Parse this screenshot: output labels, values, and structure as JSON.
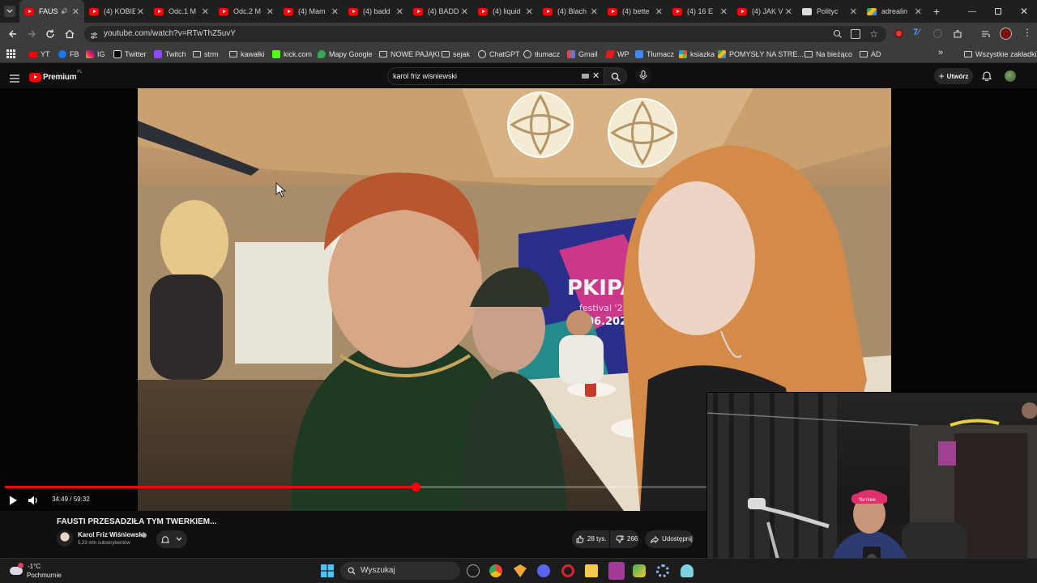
{
  "tabs": [
    {
      "title": "FAUS",
      "active": true
    },
    {
      "title": "(4) KOBIE"
    },
    {
      "title": "Odc.1 M"
    },
    {
      "title": "Odc.2 M"
    },
    {
      "title": "(4) Mam"
    },
    {
      "title": "(4) badd"
    },
    {
      "title": "(4) BADD"
    },
    {
      "title": "(4) liquid"
    },
    {
      "title": "(4) Blach"
    },
    {
      "title": "(4) bette"
    },
    {
      "title": "(4) 16 E"
    },
    {
      "title": "(4) JAK V"
    },
    {
      "title": "Polityc"
    },
    {
      "title": "adrealin"
    }
  ],
  "address": {
    "url": "youtube.com/watch?v=RTwThZ5uvY"
  },
  "bookmarks": [
    {
      "label": "YT",
      "icon": "youtube-icon"
    },
    {
      "label": "FB",
      "icon": "facebook-icon"
    },
    {
      "label": "IG",
      "icon": "instagram-icon"
    },
    {
      "label": "Twitter",
      "icon": "x-icon"
    },
    {
      "label": "Twitch",
      "icon": "twitch-icon"
    },
    {
      "label": "strm",
      "icon": "folder-icon"
    },
    {
      "label": "kawałki",
      "icon": "folder-icon"
    },
    {
      "label": "kick.com",
      "icon": "kick-icon"
    },
    {
      "label": "Mapy Google",
      "icon": "maps-icon"
    },
    {
      "label": "NOWE PAJĄKI",
      "icon": "folder-icon"
    },
    {
      "label": "sejak",
      "icon": "folder-icon"
    },
    {
      "label": "ChatGPT",
      "icon": "chatgpt-icon"
    },
    {
      "label": "tłumacz",
      "icon": "chatgpt-icon"
    },
    {
      "label": "Gmail",
      "icon": "gmail-icon"
    },
    {
      "label": "WP",
      "icon": "wp-icon"
    },
    {
      "label": "Tłumacz",
      "icon": "translate-icon"
    },
    {
      "label": "ksiazka",
      "icon": "microsoft-icon"
    },
    {
      "label": "POMYSŁY NA STRE...",
      "icon": "drive-icon"
    },
    {
      "label": "Na bieżąco",
      "icon": "folder-icon"
    },
    {
      "label": "AD",
      "icon": "folder-icon"
    }
  ],
  "bookmarks_overflow": "»",
  "all_bookmarks": "Wszystkie zakładki",
  "youtube": {
    "logo_label": "Premium",
    "region": "PL",
    "search_value": "karol friz wisniewski",
    "create_label": "Utwórz"
  },
  "scene": {
    "banner_line1": "PKIPA",
    "banner_line2": "festival '26",
    "banner_line3": "3.06.2026"
  },
  "player": {
    "time": "34:49 / 59:32",
    "progress": 0.585
  },
  "video": {
    "title": "FAUSTI PRZESADZIŁA TYM TWERKIEM...",
    "channel": "Karol Friz Wiśniewski",
    "subscribers": "5,33 mln subskrybentów",
    "likes": "28 tys.",
    "dislikes": "266",
    "share_label": "Udostępnij"
  },
  "webcam": {
    "cap_text": "Yankee"
  },
  "taskbar": {
    "weather_temp": "-1°C",
    "weather_desc": "Pochmurnie",
    "search_placeholder": "Wyszukaj"
  },
  "colors": {
    "accent": "#ff0000",
    "chrome_dark": "#1f1f1f",
    "chrome_bar": "#3c3c3c",
    "yt_bg": "#0f0f0f"
  }
}
